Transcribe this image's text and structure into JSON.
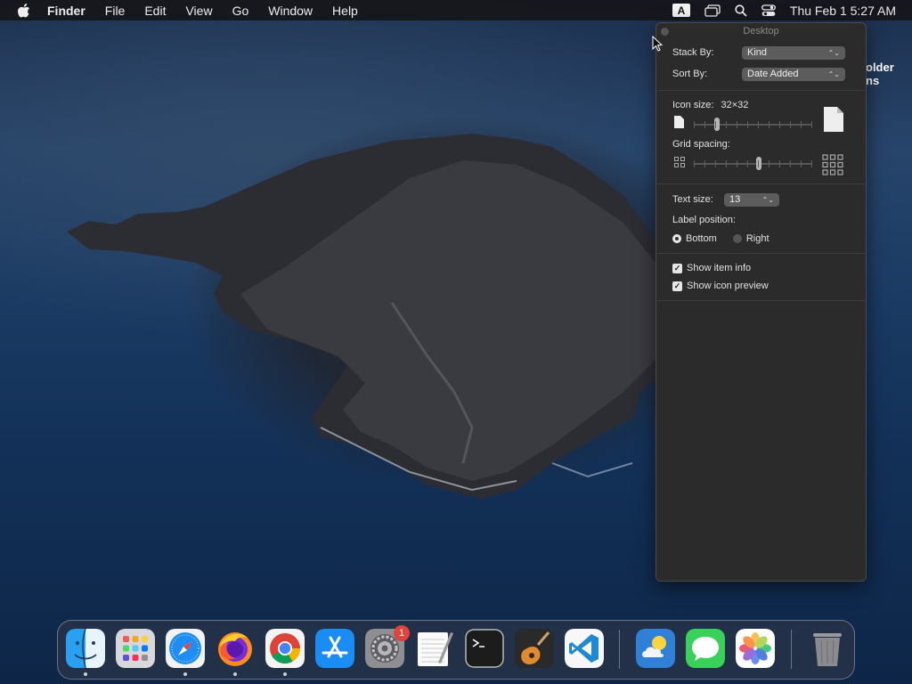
{
  "menubar": {
    "app_name": "Finder",
    "menus": [
      "File",
      "Edit",
      "View",
      "Go",
      "Window",
      "Help"
    ],
    "input_source": "A",
    "clock": "Thu Feb 1  5:27 AM"
  },
  "desktop": {
    "folder_label_line1": "older",
    "folder_label_line2": "ns"
  },
  "panel": {
    "title": "Desktop",
    "stack_by_label": "Stack By:",
    "stack_by_value": "Kind",
    "sort_by_label": "Sort By:",
    "sort_by_value": "Date Added",
    "icon_size_label": "Icon size:",
    "icon_size_value": "32×32",
    "icon_size_level": 0.2,
    "grid_spacing_label": "Grid spacing:",
    "grid_spacing_level": 0.55,
    "text_size_label": "Text size:",
    "text_size_value": "13",
    "label_position_label": "Label position:",
    "label_position_options": [
      "Bottom",
      "Right"
    ],
    "label_position_selected": "Bottom",
    "show_item_info_label": "Show item info",
    "show_item_info_checked": true,
    "show_icon_preview_label": "Show icon preview",
    "show_icon_preview_checked": true
  },
  "dock": {
    "apps": [
      {
        "name": "finder",
        "icon": "finder-icon",
        "running": true
      },
      {
        "name": "launchpad",
        "icon": "launchpad-icon",
        "running": false
      },
      {
        "name": "safari",
        "icon": "safari-icon",
        "running": true
      },
      {
        "name": "firefox",
        "icon": "firefox-icon",
        "running": true
      },
      {
        "name": "chrome",
        "icon": "chrome-icon",
        "running": true
      },
      {
        "name": "app-store",
        "icon": "app-store-icon",
        "running": false
      },
      {
        "name": "system-preferences",
        "icon": "gear-icon",
        "running": false,
        "badge": "1"
      },
      {
        "name": "textedit",
        "icon": "notepad-icon",
        "running": false
      },
      {
        "name": "terminal",
        "icon": "terminal-icon",
        "running": false
      },
      {
        "name": "garageband",
        "icon": "guitar-icon",
        "running": false
      },
      {
        "name": "vscode",
        "icon": "vscode-icon",
        "running": false
      },
      {
        "name": "weather",
        "icon": "weather-icon",
        "running": false
      },
      {
        "name": "messages",
        "icon": "messages-icon",
        "running": false
      },
      {
        "name": "photos",
        "icon": "photos-icon",
        "running": false
      },
      {
        "name": "trash",
        "icon": "trash-icon",
        "running": false
      }
    ],
    "badge_text": "1"
  }
}
